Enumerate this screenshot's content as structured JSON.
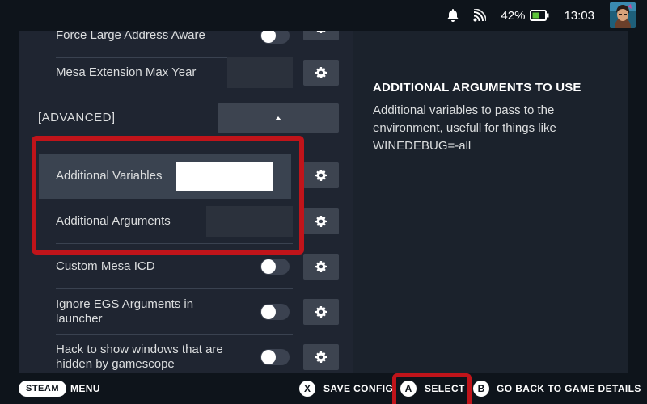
{
  "status": {
    "battery": "42%",
    "time": "13:03"
  },
  "settings": {
    "force_large_address_label": "Force Large Address Aware",
    "mesa_extension_label": "Mesa Extension Max Year",
    "advanced_header": "[ADVANCED]",
    "additional_variables_label": "Additional Variables",
    "additional_variables_value": "",
    "additional_arguments_label": "Additional Arguments",
    "custom_mesa_icd_label": "Custom Mesa ICD",
    "custom_mesa_icd_on": false,
    "ignore_egs_label": "Ignore EGS Arguments in launcher",
    "ignore_egs_on": false,
    "hack_windows_label": "Hack to show windows that are hidden by gamescope",
    "hack_windows_on": false
  },
  "help": {
    "title": "ADDITIONAL ARGUMENTS TO USE",
    "text": "Additional variables to pass to the environment, usefull for things like WINEDEBUG=-all"
  },
  "footer": {
    "steam": "STEAM",
    "menu": "MENU",
    "x_button": "X",
    "save_config": "SAVE CONFIG",
    "a_button": "A",
    "select": "SELECT",
    "b_button": "B",
    "go_back": "GO BACK TO GAME DETAILS"
  },
  "colors": {
    "highlight": "#c0141a",
    "panel": "#1f2531",
    "background": "#0e141b"
  }
}
